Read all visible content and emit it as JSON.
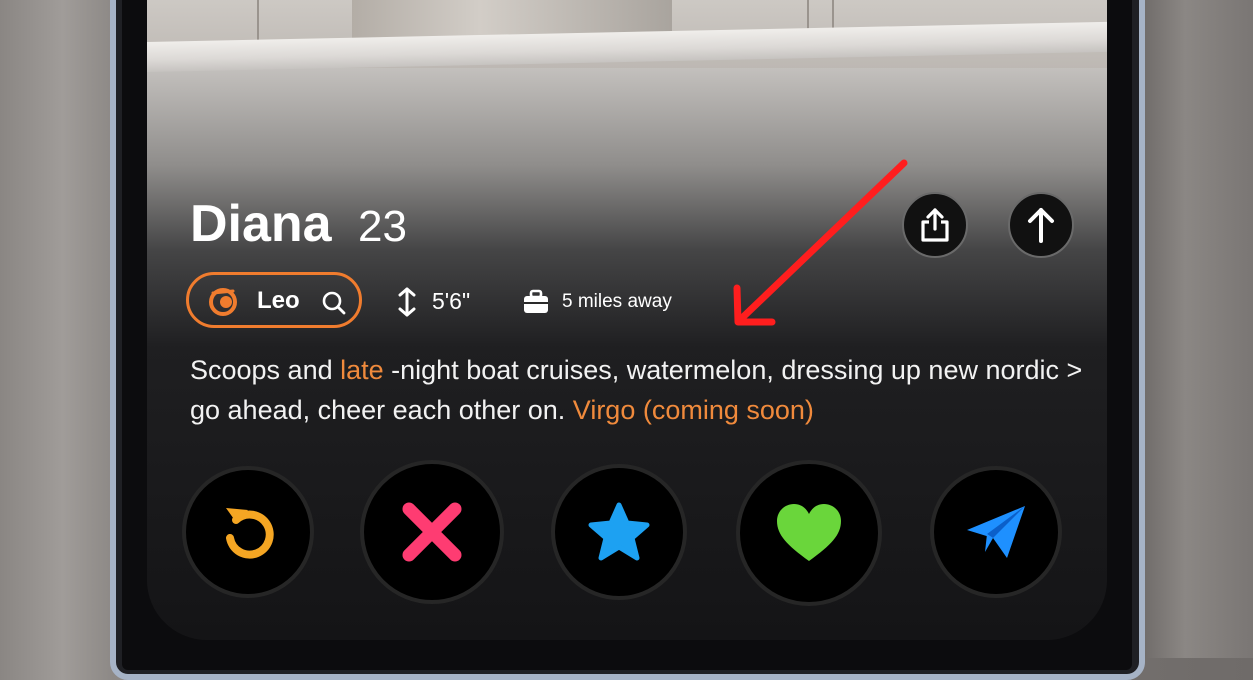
{
  "profile": {
    "name": "Diana",
    "age": "23",
    "zodiac": "Leo",
    "height": "5'6\"",
    "distance": "5 miles away"
  },
  "bio": {
    "part1": "Scoops and ",
    "accent1": "late",
    "part2": " -night boat cruises, watermelon, dressing up new nordic > go ahead, cheer each other on. ",
    "accent2": "Virgo (coming soon)"
  },
  "icons": {
    "share": "share-icon",
    "up": "arrow-up-icon",
    "zodiac": "leo-zodiac-icon",
    "search": "search-icon",
    "height": "height-arrows-icon",
    "distance": "briefcase-icon",
    "rewind": "rewind-icon",
    "nope": "x-icon",
    "superlike": "star-icon",
    "like": "heart-icon",
    "boost": "paper-plane-icon"
  },
  "colors": {
    "accent": "#f08a3c",
    "pill_border": "#f07c2e",
    "rewind": "#f5a623",
    "nope": "#fe3c72",
    "superlike": "#1da1f2",
    "like": "#6ad63b",
    "boost": "#1e90ff",
    "annotation_arrow": "#ff1e1e"
  }
}
